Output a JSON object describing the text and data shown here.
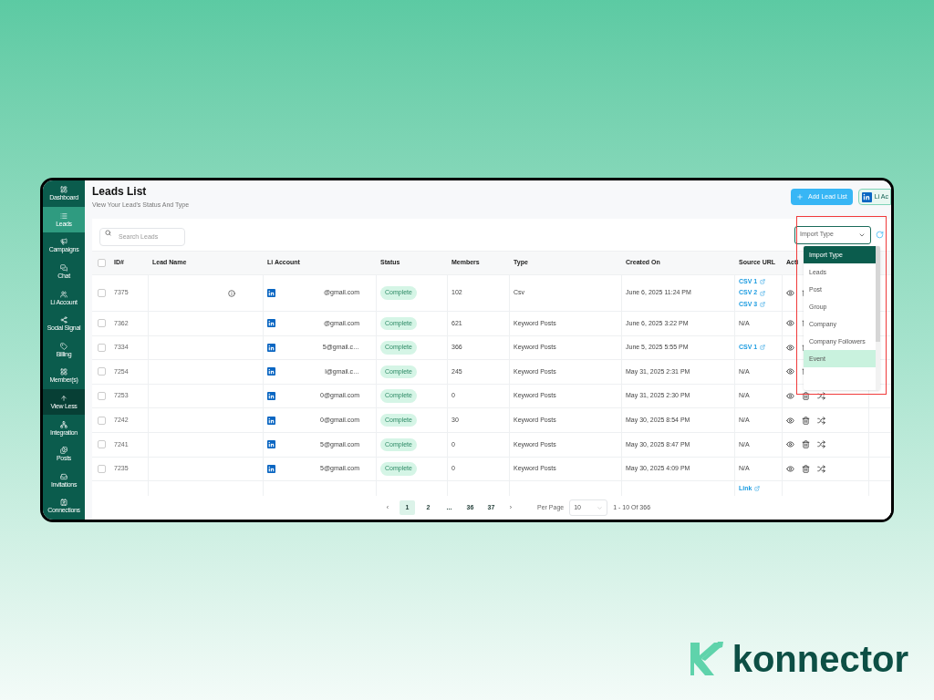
{
  "sidebar": {
    "items": [
      {
        "label": "Dashboard",
        "selected": false,
        "kind": "link"
      },
      {
        "label": "Leads",
        "selected": true,
        "kind": "link"
      },
      {
        "label": "Campaigns",
        "selected": false,
        "kind": "link"
      },
      {
        "label": "Chat",
        "selected": false,
        "kind": "link"
      },
      {
        "label": "Li Account",
        "selected": false,
        "kind": "link"
      },
      {
        "label": "Social Signal",
        "selected": false,
        "kind": "link"
      },
      {
        "label": "Billing",
        "selected": false,
        "kind": "link"
      },
      {
        "label": "Member(s)",
        "selected": false,
        "kind": "link"
      },
      {
        "label": "View Less",
        "selected": false,
        "kind": "toggle"
      },
      {
        "label": "Integration",
        "selected": false,
        "kind": "link"
      },
      {
        "label": "Posts",
        "selected": false,
        "kind": "link"
      },
      {
        "label": "Invitations",
        "selected": false,
        "kind": "link"
      },
      {
        "label": "Connections",
        "selected": false,
        "kind": "link"
      }
    ]
  },
  "header": {
    "title": "Leads List",
    "subtitle": "View Your Lead's Status And Type",
    "add_button": "Add Lead List",
    "account_button": "Li Ac"
  },
  "search": {
    "placeholder": "Search Leads"
  },
  "filter": {
    "value": "Import Type",
    "options": [
      {
        "label": "Import Type",
        "selected": true,
        "hovered": false
      },
      {
        "label": "Leads",
        "selected": false,
        "hovered": false
      },
      {
        "label": "Post",
        "selected": false,
        "hovered": false
      },
      {
        "label": "Group",
        "selected": false,
        "hovered": false
      },
      {
        "label": "Company",
        "selected": false,
        "hovered": false
      },
      {
        "label": "Company Followers",
        "selected": false,
        "hovered": false
      },
      {
        "label": "Event",
        "selected": false,
        "hovered": true
      }
    ]
  },
  "table": {
    "all_checked": false,
    "columns": [
      "ID#",
      "Lead Name",
      "Li Account",
      "Status",
      "Members",
      "Type",
      "Created On",
      "Source URL",
      "Acti"
    ],
    "rows": [
      {
        "id": "7375",
        "info": true,
        "account": "@gmail.com",
        "status": "Complete",
        "members": "102",
        "type": "Csv",
        "created": "June 6, 2025 11:24 PM",
        "source": {
          "kind": "links",
          "links": [
            "CSV 1",
            "CSV 2",
            "CSV 3"
          ]
        },
        "checked": false
      },
      {
        "id": "7362",
        "info": false,
        "account": "@gmail.com",
        "status": "Complete",
        "members": "621",
        "type": "Keyword Posts",
        "created": "June 6, 2025 3:22 PM",
        "source": {
          "kind": "text",
          "text": "N/A"
        },
        "checked": false
      },
      {
        "id": "7334",
        "info": false,
        "account": "5@gmail.c…",
        "status": "Complete",
        "members": "366",
        "type": "Keyword Posts",
        "created": "June 5, 2025 5:55 PM",
        "source": {
          "kind": "links",
          "links": [
            "CSV 1"
          ]
        },
        "checked": false
      },
      {
        "id": "7254",
        "info": false,
        "account": "l@gmail.c…",
        "status": "Complete",
        "members": "245",
        "type": "Keyword Posts",
        "created": "May 31, 2025 2:31 PM",
        "source": {
          "kind": "text",
          "text": "N/A"
        },
        "checked": false
      },
      {
        "id": "7253",
        "info": false,
        "account": "0@gmail.com",
        "status": "Complete",
        "members": "0",
        "type": "Keyword Posts",
        "created": "May 31, 2025 2:30 PM",
        "source": {
          "kind": "text",
          "text": "N/A"
        },
        "checked": false
      },
      {
        "id": "7242",
        "info": false,
        "account": "0@gmail.com",
        "status": "Complete",
        "members": "30",
        "type": "Keyword Posts",
        "created": "May 30, 2025 8:54 PM",
        "source": {
          "kind": "text",
          "text": "N/A"
        },
        "checked": false
      },
      {
        "id": "7241",
        "info": false,
        "account": "5@gmail.com",
        "status": "Complete",
        "members": "0",
        "type": "Keyword Posts",
        "created": "May 30, 2025 8:47 PM",
        "source": {
          "kind": "text",
          "text": "N/A"
        },
        "checked": false
      },
      {
        "id": "7235",
        "info": false,
        "account": "5@gmail.com",
        "status": "Complete",
        "members": "0",
        "type": "Keyword Posts",
        "created": "May 30, 2025 4:09 PM",
        "source": {
          "kind": "text",
          "text": "N/A"
        },
        "checked": false
      }
    ],
    "trailing_row": {
      "source_link": "Link"
    }
  },
  "pagination": {
    "prev": "‹",
    "next": "›",
    "pages": [
      {
        "label": "1",
        "selected": true
      },
      {
        "label": "2",
        "selected": false
      },
      {
        "label": "...",
        "selected": false
      },
      {
        "label": "36",
        "selected": false
      },
      {
        "label": "37",
        "selected": false
      }
    ],
    "per_page_label": "Per Page",
    "per_page": "10",
    "range": "1 - 10 Of 366"
  },
  "brand": {
    "name": "konnector"
  }
}
